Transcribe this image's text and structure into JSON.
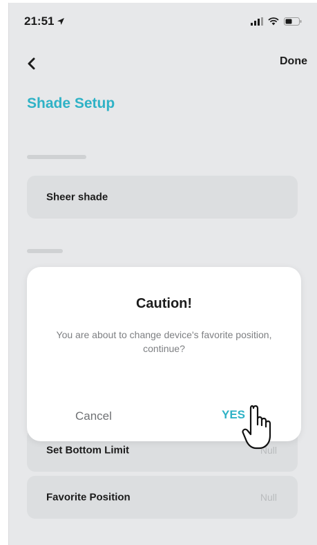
{
  "status_bar": {
    "time": "21:51",
    "location_icon": "location-arrow-icon",
    "signal_icon": "cellular-signal-icon",
    "wifi_icon": "wifi-icon",
    "battery_icon": "battery-icon"
  },
  "nav": {
    "back_icon": "chevron-left-icon",
    "done_label": "Done"
  },
  "page": {
    "title": "Shade Setup"
  },
  "rows": [
    {
      "label": "Sheer shade",
      "value": ""
    },
    {
      "label": "Set Bottom Limit",
      "value": "Null"
    },
    {
      "label": "Favorite Position",
      "value": "Null"
    }
  ],
  "dialog": {
    "title": "Caution!",
    "message": "You are about to change device's favorite position, continue?",
    "cancel_label": "Cancel",
    "confirm_label": "YES"
  },
  "cursor_icon": "hand-pointer-icon",
  "colors": {
    "accent": "#2fb2c6",
    "background": "#e7e8ea",
    "dialog_bg": "#ffffff",
    "text_primary": "#1b1b1b",
    "text_secondary": "#7d7f82"
  }
}
